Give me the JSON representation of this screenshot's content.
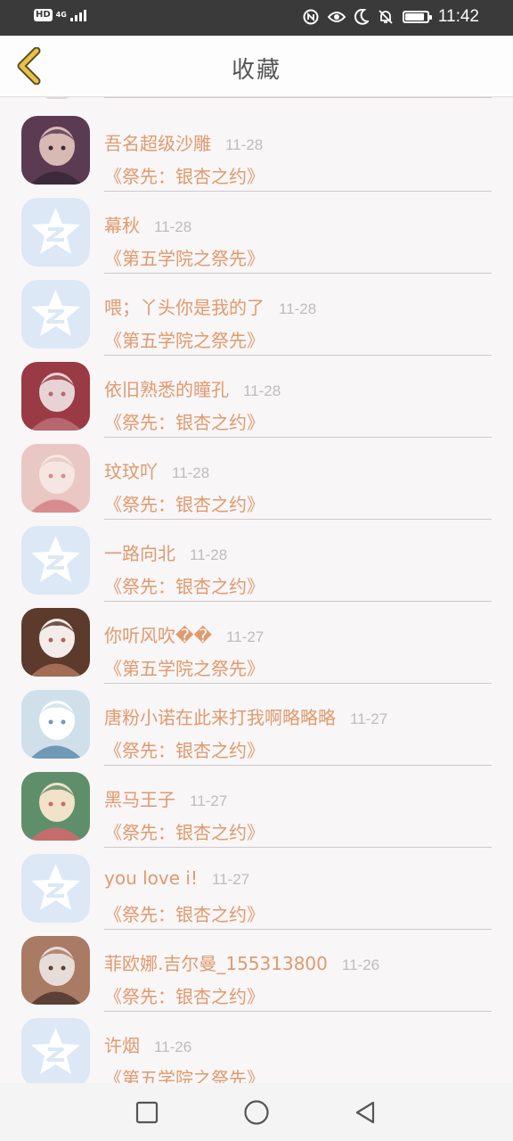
{
  "status_bar": {
    "hd": "HD",
    "network": "4G",
    "time": "11:42",
    "battery_level": 0.9
  },
  "header": {
    "title": "收藏",
    "back_icon": "chevron-left-icon",
    "accent": "#e8c341"
  },
  "colors": {
    "text_accent": "#e09a6e",
    "time_gray": "#bdbdbd",
    "default_avatar_bg": "#dce8f5"
  },
  "items": [
    {
      "name": "吾名超级沙雕",
      "time": "11-28",
      "game": "《祭先：银杏之约》",
      "avatar": "anime-avatar",
      "palette": [
        "#5b3b52",
        "#d9b9b4",
        "#3c2a3b"
      ]
    },
    {
      "name": "幕秋",
      "time": "11-28",
      "game": "《第五学院之祭先》",
      "avatar": "qzone-star-icon"
    },
    {
      "name": "喂；丫头你是我的了",
      "time": "11-28",
      "game": "《第五学院之祭先》",
      "avatar": "qzone-star-icon"
    },
    {
      "name": "依旧熟悉的瞳孔",
      "time": "11-28",
      "game": "《祭先：银杏之约》",
      "avatar": "anime-avatar",
      "palette": [
        "#9a3a45",
        "#e7d3d6",
        "#b8666f"
      ]
    },
    {
      "name": "玟玟吖",
      "time": "11-28",
      "game": "《祭先：银杏之约》",
      "avatar": "anime-avatar",
      "palette": [
        "#e9c7c2",
        "#f5e6e1",
        "#d98c8f"
      ]
    },
    {
      "name": "一路向北",
      "time": "11-28",
      "game": "《祭先：银杏之约》",
      "avatar": "qzone-star-icon"
    },
    {
      "name": "你听风吹��",
      "time": "11-27",
      "game": "《第五学院之祭先》",
      "avatar": "anime-avatar",
      "palette": [
        "#5c3a2c",
        "#f3ece8",
        "#a36c55"
      ]
    },
    {
      "name": "唐粉小诺在此来打我啊略略略",
      "time": "11-27",
      "game": "《祭先：银杏之约》",
      "avatar": "anime-avatar",
      "palette": [
        "#cfe0ea",
        "#ffffff",
        "#6e9ab6"
      ]
    },
    {
      "name": "黑马王子",
      "time": "11-27",
      "game": "《祭先：银杏之约》",
      "avatar": "anime-avatar",
      "palette": [
        "#5f8f6a",
        "#f1e2c9",
        "#c56d6d"
      ]
    },
    {
      "name": "you love i!",
      "time": "11-27",
      "game": "《祭先：银杏之约》",
      "avatar": "qzone-star-icon"
    },
    {
      "name": "菲欧娜.吉尔曼_155313800",
      "time": "11-26",
      "game": "《祭先：银杏之约》",
      "avatar": "anime-avatar",
      "palette": [
        "#a97a64",
        "#e8dcd8",
        "#5b4038"
      ]
    },
    {
      "name": "许烟",
      "time": "11-26",
      "game": "《第五学院之祭先》",
      "avatar": "qzone-star-icon"
    }
  ],
  "nav": {
    "recent": "square-icon",
    "home": "circle-icon",
    "back": "triangle-back-icon"
  }
}
